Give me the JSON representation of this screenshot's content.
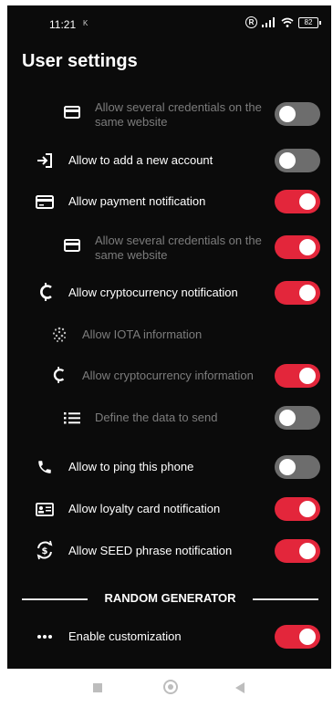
{
  "status": {
    "time": "11:21",
    "extra": "K",
    "r_badge": "R",
    "battery": "82"
  },
  "title": "User settings",
  "rows": [
    {
      "icon": "card-icon",
      "label": "Allow several credentials on the same website",
      "dim": true,
      "toggle": "off"
    },
    {
      "icon": "login-arrow-icon",
      "label": "Allow to add a new account",
      "dim": false,
      "toggle": "off"
    },
    {
      "icon": "credit-card-icon",
      "label": "Allow payment notification",
      "dim": false,
      "toggle": "on"
    },
    {
      "icon": "card-icon",
      "label": "Allow several credentials on the same website",
      "dim": true,
      "toggle": "on"
    },
    {
      "icon": "crypto-coin-icon",
      "label": "Allow cryptocurrency notification",
      "dim": false,
      "toggle": "on"
    },
    {
      "icon": "iota-icon",
      "label": "Allow IOTA information",
      "dim": true,
      "toggle": "none"
    },
    {
      "icon": "crypto-coin-icon",
      "label": "Allow cryptocurrency information",
      "dim": true,
      "toggle": "on"
    },
    {
      "icon": "list-icon",
      "label": "Define the data to send",
      "dim": true,
      "toggle": "off"
    },
    {
      "icon": "phone-icon",
      "label": "Allow to ping this phone",
      "dim": false,
      "toggle": "off"
    },
    {
      "icon": "id-card-icon",
      "label": "Allow loyalty card notification",
      "dim": false,
      "toggle": "on"
    },
    {
      "icon": "sync-dollar-icon",
      "label": "Allow SEED phrase notification",
      "dim": false,
      "toggle": "on"
    }
  ],
  "section_heading": "RANDOM GENERATOR",
  "customization": {
    "icon": "more-dots-icon",
    "label": "Enable customization",
    "toggle": "on"
  },
  "colors": {
    "accent": "#e3263b",
    "off": "#6d6d6d",
    "background": "#0b0b0b"
  }
}
